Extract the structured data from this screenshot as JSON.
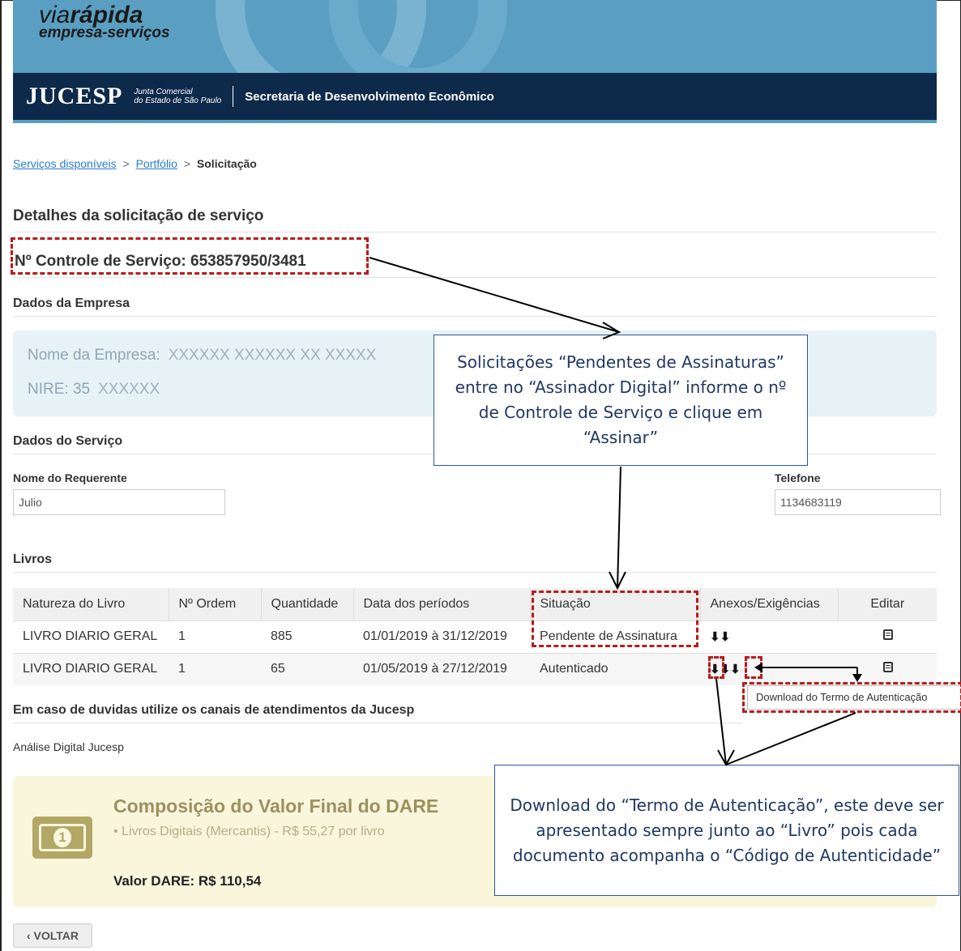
{
  "header": {
    "brand_via": "via",
    "brand_rapida": "rápida",
    "brand_sub": "empresa-serviços",
    "jucesp": "JUCESP",
    "junta_line1": "Junta Comercial",
    "junta_line2": "do Estado de São Paulo",
    "secretaria": "Secretaria de Desenvolvimento Econômico"
  },
  "breadcrumb": {
    "item1": "Serviços disponíveis",
    "item2": "Portfólio",
    "current": "Solicitação",
    "sep": ">"
  },
  "details": {
    "title": "Detalhes da solicitação de serviço",
    "controle": "Nº Controle de Serviço: 653857950/3481"
  },
  "empresa": {
    "section": "Dados da Empresa",
    "nome_label": "Nome da Empresa:",
    "nome_value": "XXXXXX XXXXXX XX XXXXX",
    "nire_label": "NIRE: 35",
    "nire_value": "XXXXXX"
  },
  "servico": {
    "section": "Dados do Serviço",
    "requerente_label": "Nome do Requerente",
    "requerente_value": "Julio",
    "telefone_label": "Telefone",
    "telefone_value": "1134683119"
  },
  "livros": {
    "section": "Livros",
    "headers": [
      "Natureza do Livro",
      "Nº Ordem",
      "Quantidade",
      "Data dos períodos",
      "Situação",
      "Anexos/Exigências",
      "Editar"
    ],
    "rows": [
      {
        "natureza": "LIVRO DIARIO GERAL",
        "ordem": "1",
        "quantidade": "885",
        "periodo": "01/01/2019 à 31/12/2019",
        "situacao": "Pendente de Assinatura",
        "anexos": "⬇⬇"
      },
      {
        "natureza": "LIVRO DIARIO GERAL",
        "ordem": "1",
        "quantidade": "65",
        "periodo": "01/05/2019 à 27/12/2019",
        "situacao": "Autenticado",
        "anexos": "⬇⬇⬇"
      }
    ],
    "tooltip": "Download do Termo de Autenticação"
  },
  "duvidas": {
    "section": "Em caso de duvidas utilize os canais de atendimentos da Jucesp",
    "text": "Análise Digital Jucesp"
  },
  "dare": {
    "title": "Composição do Valor Final do DARE",
    "item": "• Livros Digitais (Mercantis) - R$ 55,27 por livro",
    "valor": "Valor DARE: R$ 110,54",
    "coin": "1"
  },
  "voltar": "‹ VOLTAR",
  "callouts": {
    "top": "Solicitações “Pendentes de Assinaturas” entre no “Assinador Digital” informe o  nº de Controle de Serviço e clique em “Assinar”",
    "bottom": "Download do “Termo de Autenticação”, este deve ser apresentado sempre junto ao “Livro” pois cada documento acompanha o “Código de Autenticidade”"
  },
  "colors": {
    "header_bg": "#5a9fc2",
    "navbar_bg": "#0e2a4a",
    "highlight": "#b71c1c",
    "callout_border": "#2f5597"
  }
}
